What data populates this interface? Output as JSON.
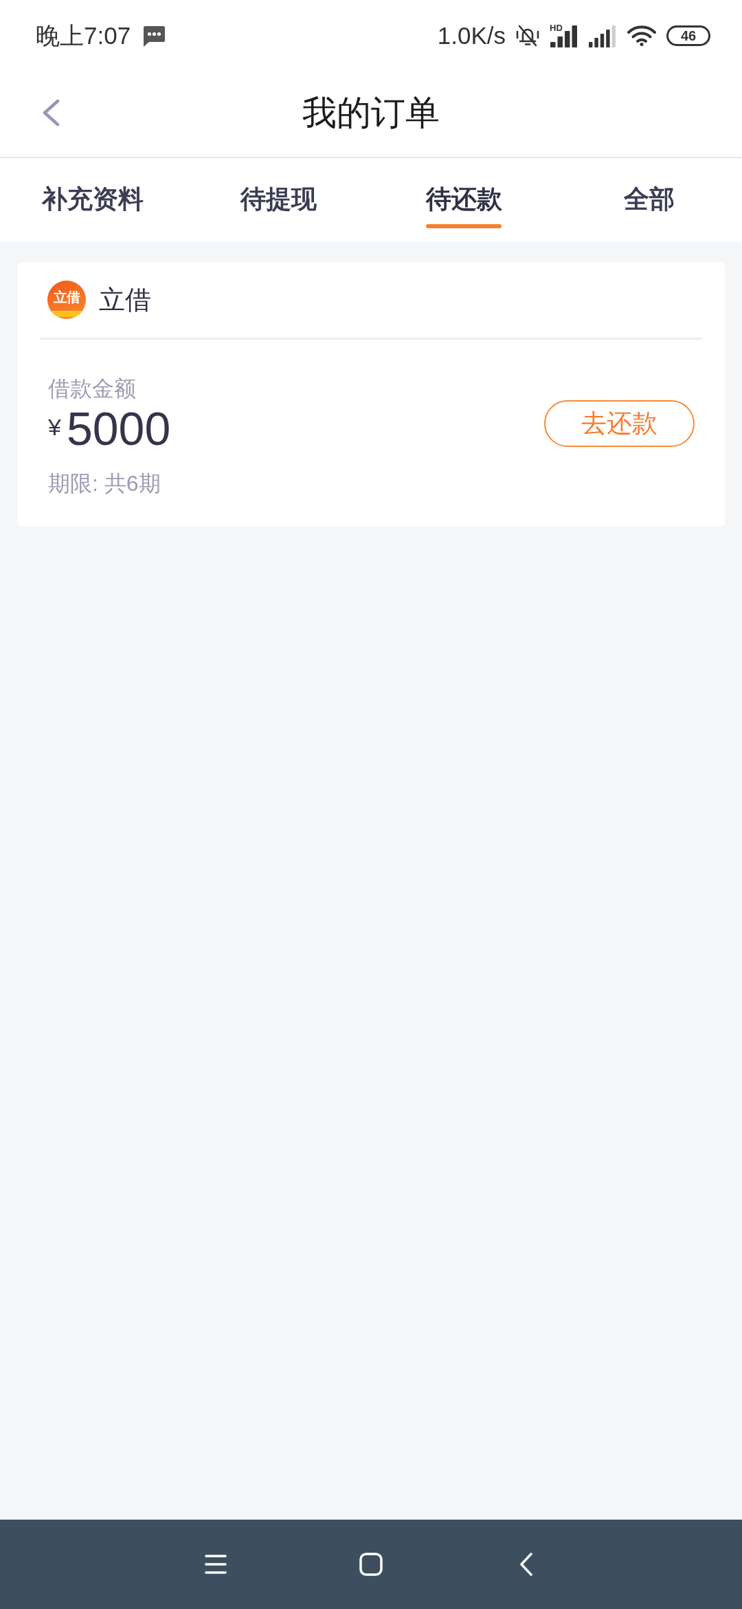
{
  "status_bar": {
    "time": "晚上7:07",
    "network_speed": "1.0K/s",
    "signal_label": "HD",
    "battery": "46"
  },
  "header": {
    "title": "我的订单"
  },
  "tabs": [
    {
      "label": "补充资料",
      "selected": false
    },
    {
      "label": "待提现",
      "selected": false
    },
    {
      "label": "待还款",
      "selected": true
    },
    {
      "label": "全部",
      "selected": false
    }
  ],
  "orders": [
    {
      "lender": "立借",
      "logo_text": "立借",
      "amount_label": "借款金额",
      "currency": "¥",
      "amount": "5000",
      "term": "期限: 共6期",
      "action": "去还款"
    }
  ]
}
